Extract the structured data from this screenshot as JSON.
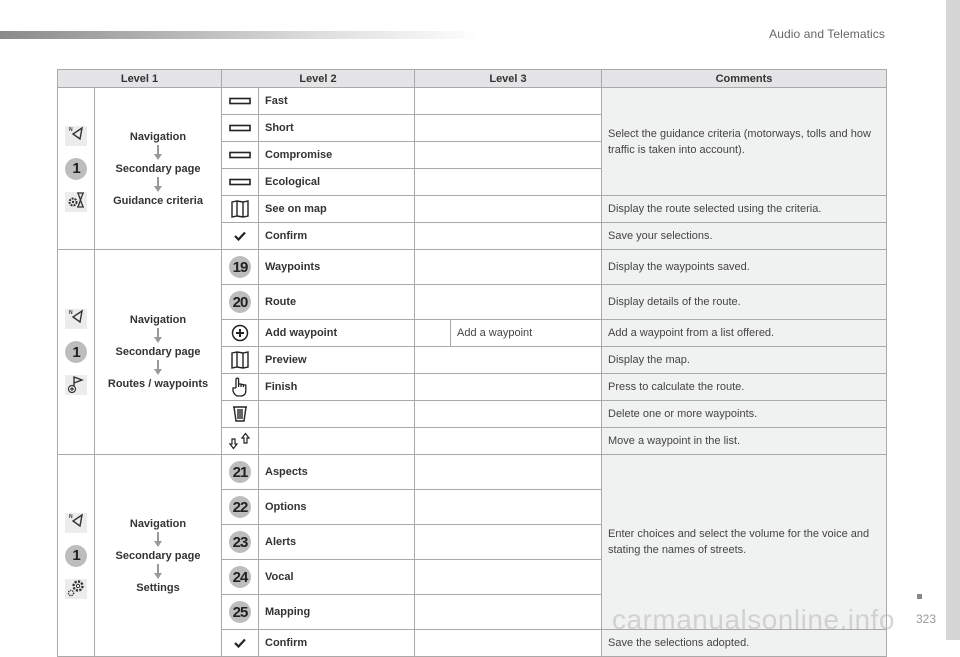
{
  "header": {
    "section_title": "Audio and Telematics",
    "page_number": "323",
    "watermark": "carmanualsonline.info"
  },
  "table": {
    "columns": [
      "Level 1",
      "Level 2",
      "Level 3",
      "Comments"
    ],
    "groups": [
      {
        "level1": {
          "icons": [
            "navigation-icon",
            "badge-1",
            "guidance-criteria-icon"
          ],
          "badge": "1",
          "steps": [
            "Navigation",
            "Secondary page",
            "Guidance criteria"
          ]
        },
        "rows": [
          {
            "icon": "bar-icon",
            "label": "Fast",
            "level3": ""
          },
          {
            "icon": "bar-icon",
            "label": "Short",
            "level3": ""
          },
          {
            "icon": "bar-icon",
            "label": "Compromise",
            "level3": ""
          },
          {
            "icon": "bar-icon",
            "label": "Ecological",
            "level3": ""
          },
          {
            "icon": "map-icon",
            "label": "See on map",
            "level3": "",
            "comment": "Display the route selected using the criteria."
          },
          {
            "icon": "check-icon",
            "label": "Confirm",
            "level3": "",
            "comment": "Save your selections."
          }
        ],
        "shared_comment": "Select the guidance criteria (motorways, tolls and how traffic is taken into account)."
      },
      {
        "level1": {
          "icons": [
            "navigation-icon",
            "badge-1",
            "routes-waypoints-icon"
          ],
          "badge": "1",
          "steps": [
            "Navigation",
            "Secondary page",
            "Routes / waypoints"
          ]
        },
        "rows": [
          {
            "icon": "badge",
            "badge": "19",
            "label": "Waypoints",
            "comment": "Display the waypoints saved."
          },
          {
            "icon": "badge",
            "badge": "20",
            "label": "Route",
            "comment": "Display details of the route."
          },
          {
            "icon": "plus-circle-icon",
            "label": "Add waypoint",
            "level3": "Add a waypoint",
            "comment": "Add a waypoint from a list offered."
          },
          {
            "icon": "map-icon",
            "label": "Preview",
            "comment": "Display the map."
          },
          {
            "icon": "hand-pointer-icon",
            "label": "Finish",
            "comment": "Press to calculate the route."
          },
          {
            "icon": "trash-icon",
            "label": "",
            "comment": "Delete one or more waypoints."
          },
          {
            "icon": "move-arrows-icon",
            "label": "",
            "comment": "Move a waypoint in the list."
          }
        ]
      },
      {
        "level1": {
          "icons": [
            "navigation-icon",
            "badge-1",
            "settings-icon"
          ],
          "badge": "1",
          "steps": [
            "Navigation",
            "Secondary page",
            "Settings"
          ]
        },
        "rows": [
          {
            "icon": "badge",
            "badge": "21",
            "label": "Aspects"
          },
          {
            "icon": "badge",
            "badge": "22",
            "label": "Options"
          },
          {
            "icon": "badge",
            "badge": "23",
            "label": "Alerts"
          },
          {
            "icon": "badge",
            "badge": "24",
            "label": "Vocal"
          },
          {
            "icon": "badge",
            "badge": "25",
            "label": "Mapping"
          },
          {
            "icon": "check-icon",
            "label": "Confirm",
            "comment": "Save the selections adopted."
          }
        ],
        "shared_comment": "Enter choices and select the volume for the voice and stating the names of streets."
      }
    ]
  }
}
